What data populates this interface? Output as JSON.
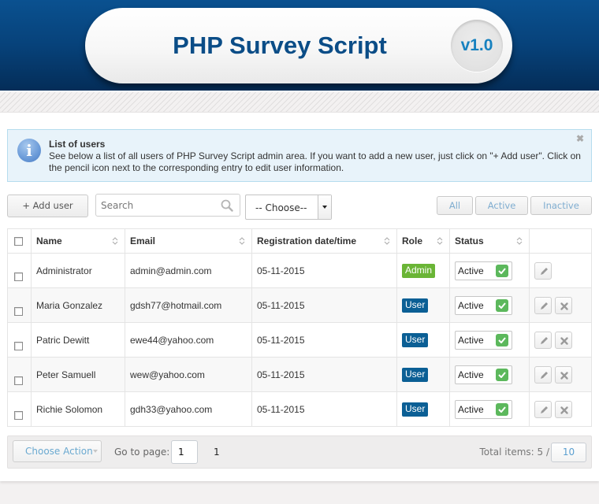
{
  "header": {
    "title": "PHP Survey Script",
    "version": "v1.0"
  },
  "alert": {
    "icon": "info-icon",
    "title": "List of users",
    "text": "See below a list of all users of PHP Survey Script admin area. If you want to add a new user, just click on \"+ Add user\". Click on the pencil icon next to the corresponding entry to edit user information.",
    "close_symbol": "✖"
  },
  "toolbar": {
    "add_user_label": "+ Add user",
    "search_placeholder": "Search",
    "search_value": "",
    "select_value": "-- Choose--",
    "filters": [
      "All",
      "Active",
      "Inactive"
    ]
  },
  "table": {
    "columns": [
      "Name",
      "Email",
      "Registration date/time",
      "Role",
      "Status"
    ],
    "rows": [
      {
        "name": "Administrator",
        "email": "admin@admin.com",
        "date": "05-11-2015",
        "role": "Admin",
        "status": "Active",
        "deletable": false
      },
      {
        "name": "Maria Gonzalez",
        "email": "gdsh77@hotmail.com",
        "date": "05-11-2015",
        "role": "User",
        "status": "Active",
        "deletable": true
      },
      {
        "name": "Patric Dewitt",
        "email": "ewe44@yahoo.com",
        "date": "05-11-2015",
        "role": "User",
        "status": "Active",
        "deletable": true
      },
      {
        "name": "Peter Samuell",
        "email": "wew@yahoo.com",
        "date": "05-11-2015",
        "role": "User",
        "status": "Active",
        "deletable": true
      },
      {
        "name": "Richie Solomon",
        "email": "gdh33@yahoo.com",
        "date": "05-11-2015",
        "role": "User",
        "status": "Active",
        "deletable": true
      }
    ]
  },
  "footer": {
    "choose_action_label": "Choose Action",
    "goto_label": "Go to page:",
    "goto_value": "1",
    "page_link": "1",
    "total_label": "Total items: 5 /",
    "per_page": "10"
  },
  "colors": {
    "brand_blue": "#0b4d87",
    "version_blue": "#1781bf",
    "admin_badge": "#6ab536",
    "user_badge": "#0b5f95",
    "status_check": "#5cb85c"
  }
}
